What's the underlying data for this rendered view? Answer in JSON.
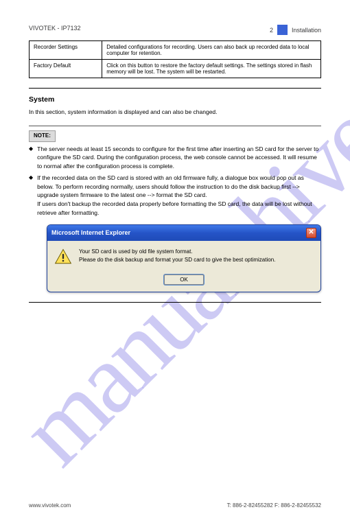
{
  "header": {
    "model": "VIVOTEK - IP7132",
    "chapter_prefix": "2",
    "chapter_title": "Installation"
  },
  "table": {
    "r1c1": "Recorder Settings",
    "r1c2": "Detailed configurations for recording. Users can also back up recorded data to local computer for retention.",
    "r2c1": "Factory Default",
    "r2c2": "Click on this button to restore the factory default settings. The settings stored in flash memory will be lost. The system will be restarted."
  },
  "section_title": "System",
  "para1": "In this section, system information is displayed and can also be changed.",
  "notes_heading": "NOTE:",
  "note1": "The server needs at least 15 seconds to configure for the first time after inserting an SD card for the server to configure the SD card. During the configuration process, the web console cannot be accessed. It will resume to normal after the configuration process is complete.",
  "note2_a": "If the recorded data on the SD card is stored with an old firmware fully, a dialogue box would pop out as below. To perform recording normally, users should follow the instruction to do the disk backup first --> upgrade system firmware to the latest one --> format the SD card.",
  "note2_b": "If users don't backup the recorded data properly before formatting the SD card, the data will be lost without retrieve after formatting.",
  "dialog": {
    "title": "Microsoft Internet Explorer",
    "line1": "Your SD card is used by old file system format.",
    "line2": "Please do the disk backup and format your SD card to give the best optimization.",
    "ok": "OK"
  },
  "footer": {
    "left": "www.vivotek.com",
    "right": "T: 886-2-82455282   F: 886-2-82455532"
  },
  "watermark": "manualshive.com"
}
